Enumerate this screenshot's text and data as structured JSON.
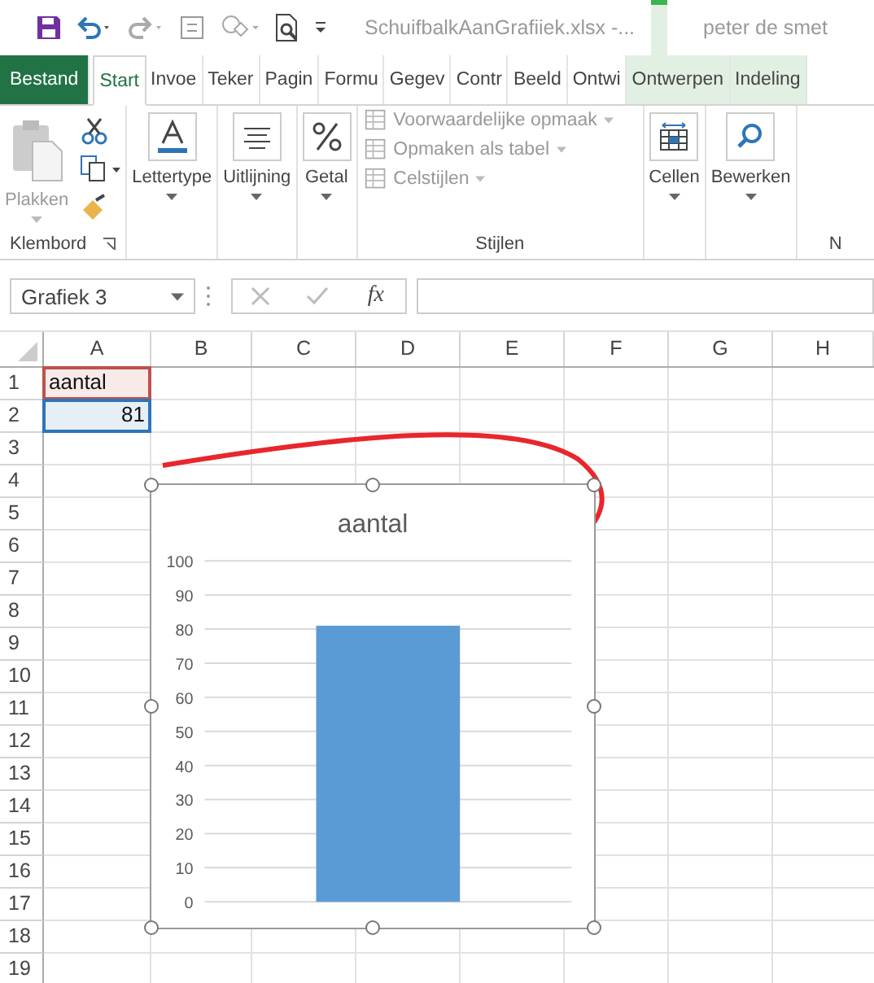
{
  "title_bar": {
    "file_title": "SchuifbalkAanGrafiiek.xlsx -...",
    "user": "peter de smet"
  },
  "tabs": [
    {
      "label": "Bestand",
      "kind": "file",
      "selected": false
    },
    {
      "label": "Start",
      "kind": "normal",
      "selected": true
    },
    {
      "label": "Invoe",
      "kind": "normal",
      "selected": false
    },
    {
      "label": "Teker",
      "kind": "normal",
      "selected": false
    },
    {
      "label": "Pagin",
      "kind": "normal",
      "selected": false
    },
    {
      "label": "Formu",
      "kind": "normal",
      "selected": false
    },
    {
      "label": "Gegev",
      "kind": "normal",
      "selected": false
    },
    {
      "label": "Contr",
      "kind": "normal",
      "selected": false
    },
    {
      "label": "Beeld",
      "kind": "normal",
      "selected": false
    },
    {
      "label": "Ontwi",
      "kind": "normal",
      "selected": false
    },
    {
      "label": "Ontwerpen",
      "kind": "contextual",
      "selected": false
    },
    {
      "label": "Indeling",
      "kind": "contextual",
      "selected": false
    }
  ],
  "ribbon": {
    "clipboard": {
      "paste_label": "Plakken",
      "paste_disabled": true,
      "group_label": "Klembord"
    },
    "big_buttons": [
      {
        "label": "Lettertype",
        "kind": "font"
      },
      {
        "label": "Uitlijning",
        "kind": "align"
      },
      {
        "label": "Getal",
        "kind": "number"
      }
    ],
    "styles": {
      "items": [
        {
          "label": "Voorwaardelijke opmaak",
          "disabled": true
        },
        {
          "label": "Opmaken als tabel",
          "disabled": true
        },
        {
          "label": "Celstijlen",
          "disabled": true
        }
      ],
      "group_label": "Stijlen"
    },
    "right_buttons": [
      {
        "label": "Cellen",
        "kind": "cells"
      },
      {
        "label": "Bewerken",
        "kind": "find"
      }
    ],
    "cut_group_label": "N"
  },
  "formula_bar": {
    "name_box": "Grafiek 3",
    "fx": "fx"
  },
  "grid": {
    "columns": [
      "A",
      "B",
      "C",
      "D",
      "E",
      "F",
      "G",
      "H"
    ],
    "rows": [
      {
        "header": "1",
        "cells": [
          {
            "text": "aantal",
            "kind": "text",
            "color": "#c0504d"
          }
        ]
      },
      {
        "header": "2",
        "cells": [
          {
            "text": "81",
            "kind": "number",
            "color": "#2e75b6"
          }
        ]
      },
      {
        "header": "3"
      },
      {
        "header": "4"
      },
      {
        "header": "5"
      },
      {
        "header": "6"
      },
      {
        "header": "7"
      },
      {
        "header": "8"
      },
      {
        "header": "9"
      },
      {
        "header": "10"
      },
      {
        "header": "11"
      },
      {
        "header": "12"
      },
      {
        "header": "13"
      },
      {
        "header": "14"
      },
      {
        "header": "15"
      },
      {
        "header": "16"
      },
      {
        "header": "17"
      },
      {
        "header": "18"
      },
      {
        "header": "19"
      }
    ]
  },
  "chart": {
    "chart_data": {
      "type": "bar",
      "title": "aantal",
      "series": [
        {
          "color": "#5b9bd5",
          "values": [
            81
          ]
        }
      ],
      "grid": true,
      "ylim": [
        0,
        100
      ],
      "yticks": [
        0,
        10,
        20,
        30,
        40,
        50,
        60,
        70,
        80,
        90,
        100
      ]
    }
  }
}
